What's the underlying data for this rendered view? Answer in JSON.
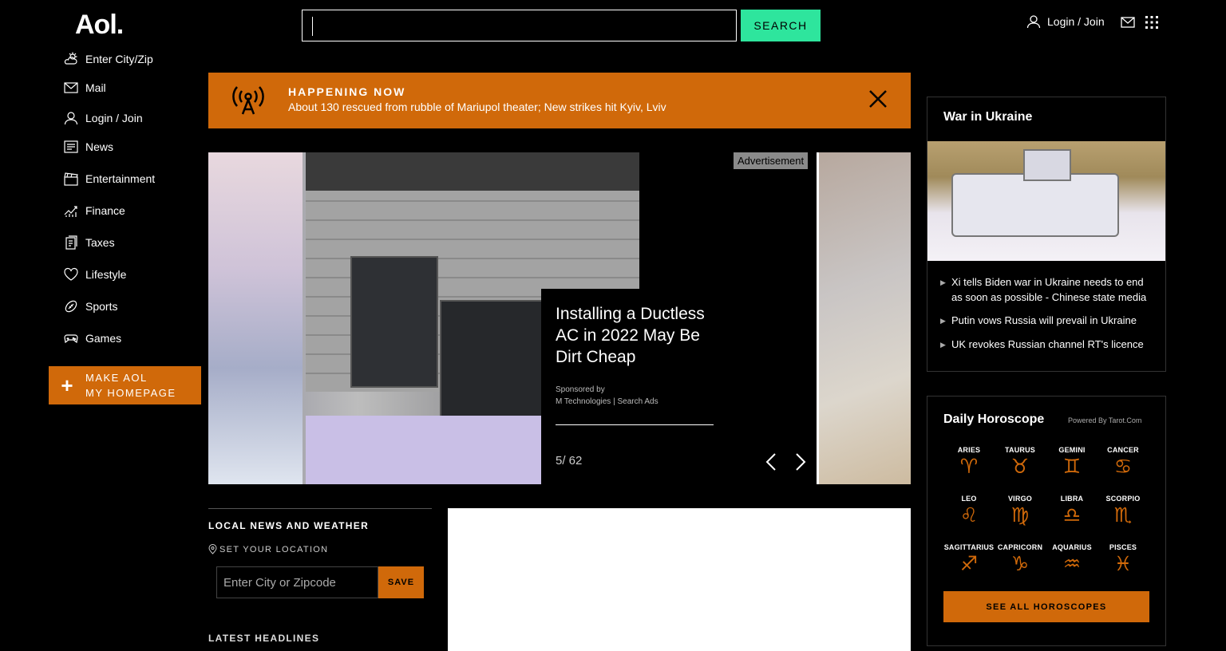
{
  "header": {
    "logo": "Aol.",
    "search_placeholder": "",
    "search_button": "SEARCH",
    "login_label": "Login / Join"
  },
  "sidebar": {
    "items": [
      {
        "label": "Enter City/Zip",
        "icon": "weather-icon"
      },
      {
        "label": "Mail",
        "icon": "mail-icon"
      },
      {
        "label": "Login / Join",
        "icon": "user-icon"
      },
      {
        "label": "News",
        "icon": "news-icon"
      },
      {
        "label": "Entertainment",
        "icon": "clapperboard-icon"
      },
      {
        "label": "Finance",
        "icon": "chart-icon"
      },
      {
        "label": "Taxes",
        "icon": "taxes-icon"
      },
      {
        "label": "Lifestyle",
        "icon": "heart-icon"
      },
      {
        "label": "Sports",
        "icon": "football-icon"
      },
      {
        "label": "Games",
        "icon": "gamepad-icon"
      }
    ],
    "make_homepage_line1": "MAKE AOL",
    "make_homepage_line2": "MY HOMEPAGE"
  },
  "banner": {
    "title": "HAPPENING NOW",
    "text": "About 130 rescued from rubble of Mariupol theater; New strikes hit Kyiv, Lviv"
  },
  "slideshow": {
    "title": "Installing a Ductless AC in 2022 May Be Dirt Cheap",
    "sponsored_by": "Sponsored by",
    "sponsor": "M Technologies | Search Ads",
    "counter": "5/ 62",
    "ad_label": "Advertisement"
  },
  "local": {
    "title": "LOCAL NEWS AND WEATHER",
    "set_location": "SET YOUR LOCATION",
    "zip_placeholder": "Enter City or Zipcode",
    "save_button": "SAVE",
    "latest_headlines": "LATEST HEADLINES"
  },
  "war": {
    "title": "War in Ukraine",
    "headlines": [
      "Xi tells Biden war in Ukraine needs to end as soon as possible - Chinese state media",
      "Putin vows Russia will prevail in Ukraine",
      "UK revokes Russian channel RT's licence"
    ]
  },
  "horoscope": {
    "title": "Daily Horoscope",
    "powered_by": "Powered By Tarot.Com",
    "signs": [
      {
        "name": "ARIES",
        "glyph": "♈"
      },
      {
        "name": "TAURUS",
        "glyph": "♉"
      },
      {
        "name": "GEMINI",
        "glyph": "♊"
      },
      {
        "name": "CANCER",
        "glyph": "♋"
      },
      {
        "name": "LEO",
        "glyph": "♌"
      },
      {
        "name": "VIRGO",
        "glyph": "♍"
      },
      {
        "name": "LIBRA",
        "glyph": "♎"
      },
      {
        "name": "SCORPIO",
        "glyph": "♏"
      },
      {
        "name": "SAGITTARIUS",
        "glyph": "♐"
      },
      {
        "name": "CAPRICORN",
        "glyph": "♑"
      },
      {
        "name": "AQUARIUS",
        "glyph": "♒"
      },
      {
        "name": "PISCES",
        "glyph": "♓"
      }
    ],
    "see_all": "SEE ALL HOROSCOPES"
  },
  "colors": {
    "accent": "#d0690a",
    "search_button": "#2ee59d",
    "background": "#000000"
  }
}
